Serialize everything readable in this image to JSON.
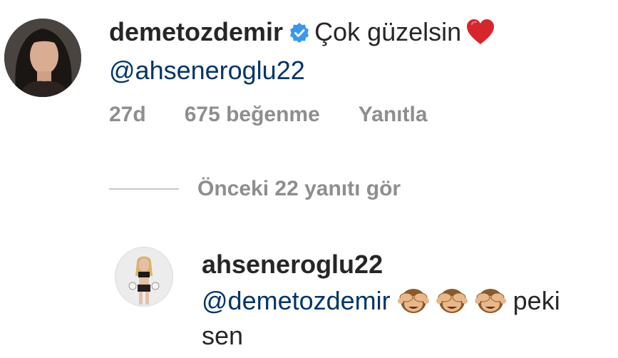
{
  "comment": {
    "username": "demetozdemir",
    "verified": true,
    "text": "Çok güzelsin",
    "emoji": "red-heart",
    "mention": "@ahseneroglu22",
    "time": "27d",
    "likes": "675 beğenme",
    "reply_label": "Yanıtla"
  },
  "view_replies": {
    "label": "Önceki 22 yanıtı gör"
  },
  "reply": {
    "username": "ahseneroglu22",
    "mention": "@demetozdemir",
    "emojis": [
      "see-no-evil-monkey",
      "see-no-evil-monkey",
      "see-no-evil-monkey"
    ],
    "text_end": "peki",
    "text_line2": "sen"
  },
  "colors": {
    "mention": "#003569",
    "meta": "#8e8e8e",
    "verified": "#3897f0",
    "heart": "#ed4956"
  }
}
